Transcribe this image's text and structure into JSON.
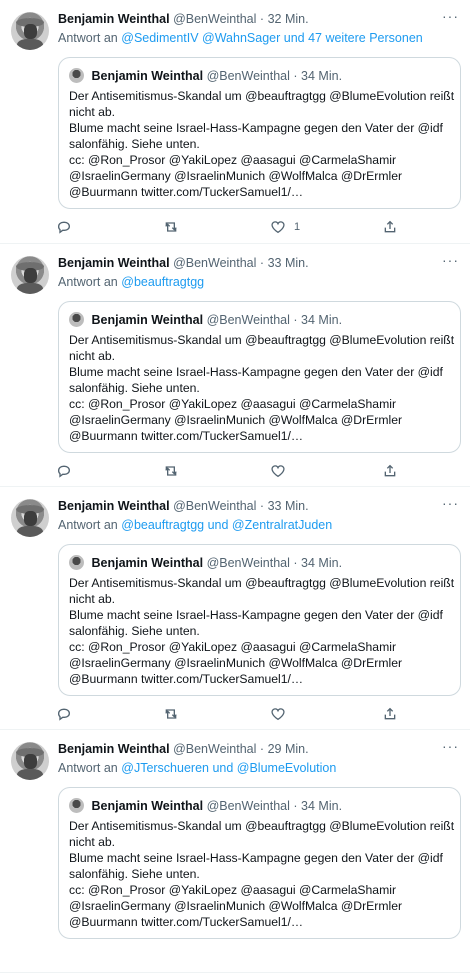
{
  "tweets": [
    {
      "author_name": "Benjamin Weinthal",
      "handle": "@BenWeinthal",
      "time": "32 Min.",
      "reply_prefix": "Antwort an",
      "reply_targets": "@SedimentIV @WahnSager und 47 weitere Personen",
      "quote": {
        "author_name": "Benjamin Weinthal",
        "handle": "@BenWeinthal",
        "time": "34 Min.",
        "lines": [
          "Der Antisemitismus-Skandal um @beauftragtgg @BlumeEvolution reißt",
          "nicht ab.",
          "Blume macht seine Israel-Hass-Kampagne gegen den Vater der @idf",
          "salonfähig. Siehe unten.",
          "cc: @Ron_Prosor @YakiLopez @aasagui @CarmelaShamir",
          "@IsraelinGermany @IsraelinMunich @WolfMalca @DrErmler",
          "@Buurmann twitter.com/TuckerSamuel1/…"
        ]
      },
      "like_count": "1"
    },
    {
      "author_name": "Benjamin Weinthal",
      "handle": "@BenWeinthal",
      "time": "33 Min.",
      "reply_prefix": "Antwort an",
      "reply_targets": "@beauftragtgg",
      "quote": {
        "author_name": "Benjamin Weinthal",
        "handle": "@BenWeinthal",
        "time": "34 Min.",
        "lines": [
          "Der Antisemitismus-Skandal um @beauftragtgg @BlumeEvolution reißt",
          "nicht ab.",
          "Blume macht seine Israel-Hass-Kampagne gegen den Vater der @idf",
          "salonfähig. Siehe unten.",
          "cc: @Ron_Prosor @YakiLopez @aasagui @CarmelaShamir",
          "@IsraelinGermany @IsraelinMunich @WolfMalca @DrErmler",
          "@Buurmann twitter.com/TuckerSamuel1/…"
        ]
      },
      "like_count": ""
    },
    {
      "author_name": "Benjamin Weinthal",
      "handle": "@BenWeinthal",
      "time": "33 Min.",
      "reply_prefix": "Antwort an",
      "reply_targets": "@beauftragtgg und @ZentralratJuden",
      "quote": {
        "author_name": "Benjamin Weinthal",
        "handle": "@BenWeinthal",
        "time": "34 Min.",
        "lines": [
          "Der Antisemitismus-Skandal um @beauftragtgg @BlumeEvolution reißt",
          "nicht ab.",
          "Blume macht seine Israel-Hass-Kampagne gegen den Vater der @idf",
          "salonfähig. Siehe unten.",
          "cc: @Ron_Prosor @YakiLopez @aasagui @CarmelaShamir",
          "@IsraelinGermany @IsraelinMunich @WolfMalca @DrErmler",
          "@Buurmann twitter.com/TuckerSamuel1/…"
        ]
      },
      "like_count": ""
    },
    {
      "author_name": "Benjamin Weinthal",
      "handle": "@BenWeinthal",
      "time": "29 Min.",
      "reply_prefix": "Antwort an",
      "reply_targets": "@JTerschueren und @BlumeEvolution",
      "quote": {
        "author_name": "Benjamin Weinthal",
        "handle": "@BenWeinthal",
        "time": "34 Min.",
        "lines": [
          "Der Antisemitismus-Skandal um @beauftragtgg @BlumeEvolution reißt",
          "nicht ab.",
          "Blume macht seine Israel-Hass-Kampagne gegen den Vater der @idf",
          "salonfähig. Siehe unten.",
          "cc: @Ron_Prosor @YakiLopez @aasagui @CarmelaShamir",
          "@IsraelinGermany @IsraelinMunich @WolfMalca @DrErmler",
          "@Buurmann twitter.com/TuckerSamuel1/…"
        ]
      },
      "like_count": ""
    }
  ],
  "icons": {
    "reply": "reply-icon",
    "retweet": "retweet-icon",
    "like": "heart-icon",
    "share": "share-icon",
    "more": "more-icon"
  },
  "colors": {
    "link": "#1d9bf0",
    "secondary_text": "#536471",
    "border": "#cfd9de"
  }
}
